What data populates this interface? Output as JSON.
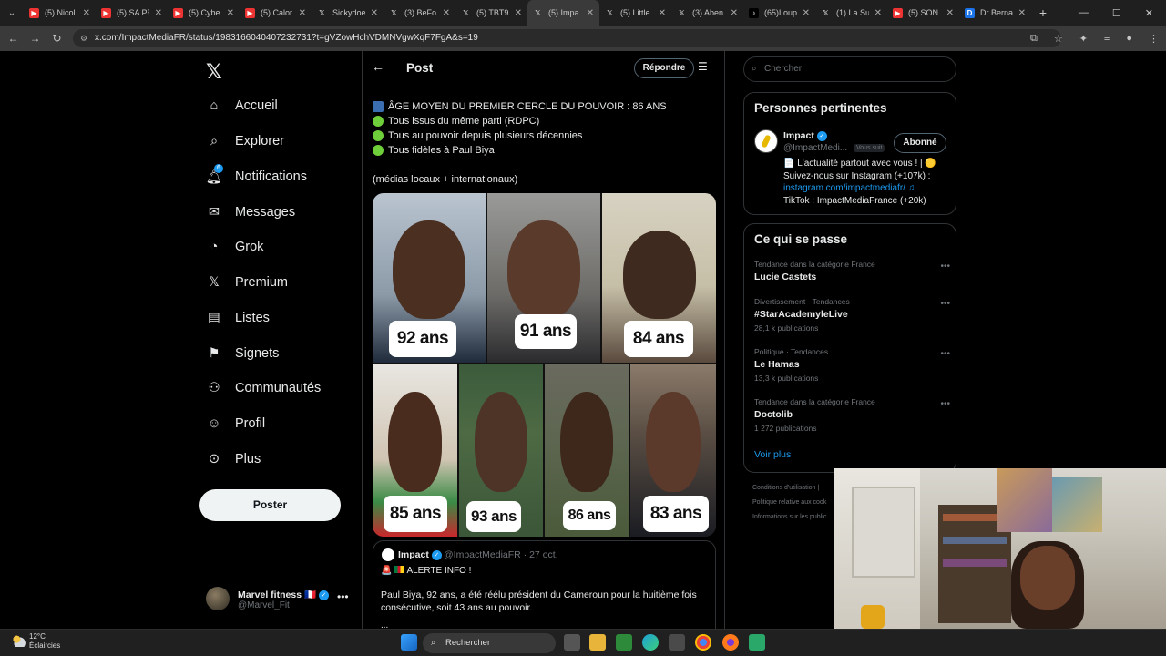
{
  "browser": {
    "tabs": [
      {
        "label": "(5) Nicol",
        "icon": "youtube-icon"
      },
      {
        "label": "(5) SA PE",
        "icon": "youtube-icon"
      },
      {
        "label": "(5) Cybe",
        "icon": "youtube-icon"
      },
      {
        "label": "(5) Calor",
        "icon": "youtube-icon"
      },
      {
        "label": "Sickydoe",
        "icon": "x-icon"
      },
      {
        "label": "(3) BeFo",
        "icon": "x-icon"
      },
      {
        "label": "(5) TBT9",
        "icon": "x-icon"
      },
      {
        "label": "(5) Impa",
        "icon": "x-icon",
        "active": true
      },
      {
        "label": "(5) Little",
        "icon": "x-icon"
      },
      {
        "label": "(3) Aben",
        "icon": "x-icon"
      },
      {
        "label": "(65)Loup",
        "icon": "tiktok-icon"
      },
      {
        "label": "(1) La Su",
        "icon": "x-icon"
      },
      {
        "label": "(5) SON",
        "icon": "youtube-icon"
      },
      {
        "label": "Dr Berna",
        "icon": "doc-icon"
      }
    ],
    "url": "x.com/ImpactMediaFR/status/1983166040407232731?t=gVZowHchVDMNVgwXqF7FgA&s=19"
  },
  "sidebar": {
    "items": [
      {
        "label": "Accueil",
        "icon": "home-icon"
      },
      {
        "label": "Explorer",
        "icon": "search-icon"
      },
      {
        "label": "Notifications",
        "icon": "bell-icon",
        "badge": "6"
      },
      {
        "label": "Messages",
        "icon": "mail-icon"
      },
      {
        "label": "Grok",
        "icon": "grok-icon"
      },
      {
        "label": "Premium",
        "icon": "x-logo-icon"
      },
      {
        "label": "Listes",
        "icon": "list-icon"
      },
      {
        "label": "Signets",
        "icon": "bookmark-icon"
      },
      {
        "label": "Communautés",
        "icon": "communities-icon"
      },
      {
        "label": "Profil",
        "icon": "profile-icon"
      },
      {
        "label": "Plus",
        "icon": "more-icon"
      }
    ],
    "post_label": "Poster",
    "account": {
      "name": "Marvel fitness 🇫🇷",
      "handle": "@Marvel_Fit"
    }
  },
  "post": {
    "header_title": "Post",
    "reply_label": "Répondre",
    "lines": [
      {
        "icon": "chart-icon",
        "text": "ÂGE MOYEN DU PREMIER CERCLE DU POUVOIR : 86 ANS"
      },
      {
        "icon": "green-circle-icon",
        "text": "Tous issus du même parti (RDPC)"
      },
      {
        "icon": "green-circle-icon",
        "text": "Tous au pouvoir depuis plusieurs décennies"
      },
      {
        "icon": "green-circle-icon",
        "text": "Tous fidèles à Paul Biya"
      }
    ],
    "source_note": "(médias locaux + internationaux)",
    "ages": [
      "92 ans",
      "91 ans",
      "84 ans",
      "85 ans",
      "93 ans",
      "86 ans",
      "83 ans"
    ],
    "quote": {
      "name": "Impact",
      "handle_date": "@ImpactMediaFR · 27 oct.",
      "alert": "ALERTE INFO !",
      "text": "Paul Biya, 92 ans, a été réélu président du Cameroun pour la huitième fois consécutive, soit 43 ans au pouvoir.",
      "ellipsis": "..."
    }
  },
  "right": {
    "search_placeholder": "Chercher",
    "relevant": {
      "title": "Personnes pertinentes",
      "name": "Impact",
      "handle": "@ImpactMedi...",
      "follows_you": "Vous suit",
      "follow_label": "Abonné",
      "bio_1": "📄 L'actualité partout avec vous ! | 🟡",
      "bio_2": "Suivez-nous sur Instagram (+107k) :",
      "bio_link": "instagram.com/impactmediafr/",
      "bio_3": "TikTok : ImpactMediaFrance (+20k)"
    },
    "trends_title": "Ce qui se passe",
    "trends": [
      {
        "cat": "Tendance dans la catégorie France",
        "name": "Lucie Castets",
        "count": ""
      },
      {
        "cat": "Divertissement · Tendances",
        "name": "#StarAcademyleLive",
        "count": "28,1 k publications"
      },
      {
        "cat": "Politique · Tendances",
        "name": "Le Hamas",
        "count": "13,3 k publications"
      },
      {
        "cat": "Tendance dans la catégorie France",
        "name": "Doctolib",
        "count": "1 272 publications"
      }
    ],
    "see_more": "Voir plus",
    "footer": [
      "Conditions d'utilisation  |",
      "Politique relative aux cook",
      "Informations sur les public"
    ]
  },
  "taskbar": {
    "temp": "12°C",
    "weather": "Éclaircies",
    "search": "Rechercher"
  }
}
